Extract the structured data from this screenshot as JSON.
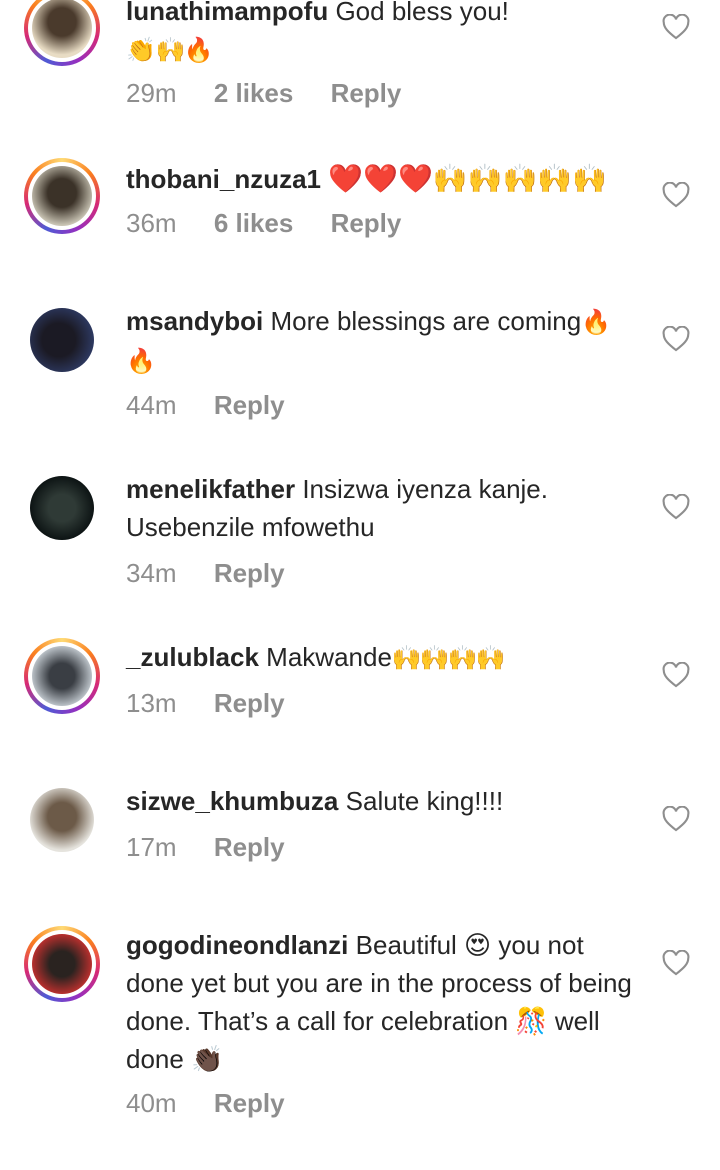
{
  "comments": [
    {
      "username": "lunathimampofu",
      "text": "God bless you!",
      "emoji_line": "👏🙌🔥",
      "time": "29m",
      "likes": "2 likes",
      "reply": "Reply",
      "story_ring": true,
      "avatar_colors": [
        "#e8dcc4",
        "#4a3a2c"
      ]
    },
    {
      "username": "thobani_nzuza1",
      "text": "❤️❤️❤️🙌🙌🙌🙌🙌",
      "time": "36m",
      "likes": "6 likes",
      "reply": "Reply",
      "story_ring": true,
      "avatar_colors": [
        "#c9c4b4",
        "#3b3228"
      ]
    },
    {
      "username": "msandyboi",
      "text": "More blessings are coming",
      "emoji_after": "🔥🔥",
      "time": "44m",
      "reply": "Reply",
      "story_ring": false,
      "avatar_colors": [
        "#2e3a63",
        "#1b1a24"
      ]
    },
    {
      "username": "menelikfather",
      "text": "Insizwa iyenza kanje. Usebenzile mfowethu",
      "time": "34m",
      "reply": "Reply",
      "story_ring": false,
      "avatar_colors": [
        "#0d1414",
        "#2f3a36"
      ]
    },
    {
      "username": "_zulublack",
      "text": "Makwande",
      "emoji_after": "🙌🙌🙌🙌",
      "time": "13m",
      "reply": "Reply",
      "story_ring": true,
      "avatar_colors": [
        "#bfc6cc",
        "#3a3e44"
      ]
    },
    {
      "username": "sizwe_khumbuza",
      "text": "Salute king!!!!",
      "time": "17m",
      "reply": "Reply",
      "story_ring": false,
      "avatar_colors": [
        "#e5e3dd",
        "#6c5a48"
      ]
    },
    {
      "username": "gogodineondlanzi",
      "text": "Beautiful 😍 you not done yet but you are in the process of being done. That’s a call for celebration 🎊 well done 👏🏿",
      "time": "40m",
      "reply": "Reply",
      "story_ring": true,
      "avatar_colors": [
        "#c7312f",
        "#2a2320"
      ]
    }
  ]
}
